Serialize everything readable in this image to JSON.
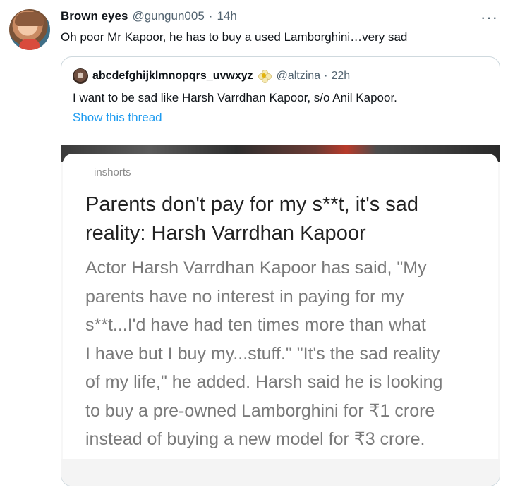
{
  "tweet": {
    "author_name": "Brown eyes",
    "author_handle": "@gungun005",
    "separator": "·",
    "time": "14h",
    "text": "Oh poor Mr Kapoor, he has to buy a used Lamborghini…very sad",
    "more_label": "···"
  },
  "quoted": {
    "author_name": "abcdefghijklmnopqrs_uvwxyz",
    "author_handle": "@altzina",
    "separator": "·",
    "time": "22h",
    "text": "I want to be sad like Harsh Varrdhan Kapoor, s/o Anil Kapoor.",
    "show_thread": "Show this thread",
    "image": {
      "source_tag": "inshorts",
      "headline_lines": [
        "Parents don't pay for my s**t, it's sad",
        "reality: Harsh Varrdhan Kapoor"
      ],
      "body_lines": [
        "Actor Harsh Varrdhan Kapoor has said, \"My",
        "parents have no interest in paying for my",
        "s**t...I'd have had ten times more than what",
        "I have but I buy my...stuff.\" \"It's the sad reality",
        "of my life,\" he added. Harsh said he is looking",
        "to buy a pre-owned Lamborghini for ₹1 crore",
        "instead of buying a new model for ₹3 crore."
      ]
    }
  }
}
